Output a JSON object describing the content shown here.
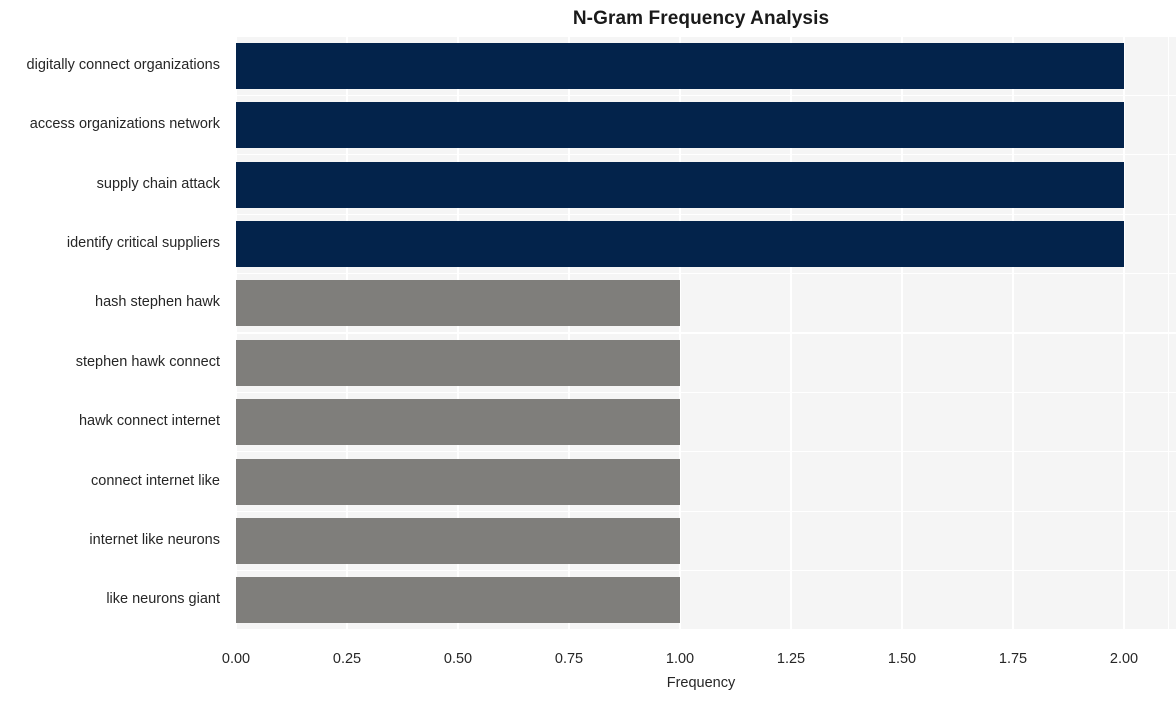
{
  "chart_data": {
    "type": "bar",
    "orientation": "horizontal",
    "title": "N-Gram Frequency Analysis",
    "xlabel": "Frequency",
    "ylabel": "",
    "categories": [
      "digitally connect organizations",
      "access organizations network",
      "supply chain attack",
      "identify critical suppliers",
      "hash stephen hawk",
      "stephen hawk connect",
      "hawk connect internet",
      "connect internet like",
      "internet like neurons",
      "like neurons giant"
    ],
    "values": [
      2,
      2,
      2,
      2,
      1,
      1,
      1,
      1,
      1,
      1
    ],
    "bar_colors": [
      "#03234b",
      "#03234b",
      "#03234b",
      "#03234b",
      "#7f7e7b",
      "#7f7e7b",
      "#7f7e7b",
      "#7f7e7b",
      "#7f7e7b",
      "#7f7e7b"
    ],
    "xlim": [
      0,
      2.08
    ],
    "xticks": [
      0,
      0.25,
      0.5,
      0.75,
      1,
      1.25,
      1.5,
      1.75,
      2
    ],
    "xtick_labels": [
      "0.00",
      "0.25",
      "0.50",
      "0.75",
      "1.00",
      "1.25",
      "1.50",
      "1.75",
      "2.00"
    ],
    "grid": true,
    "grid_color": "#ffffff",
    "plot_background": "#f5f5f5",
    "figure_background": "#ffffff",
    "legend": null
  }
}
